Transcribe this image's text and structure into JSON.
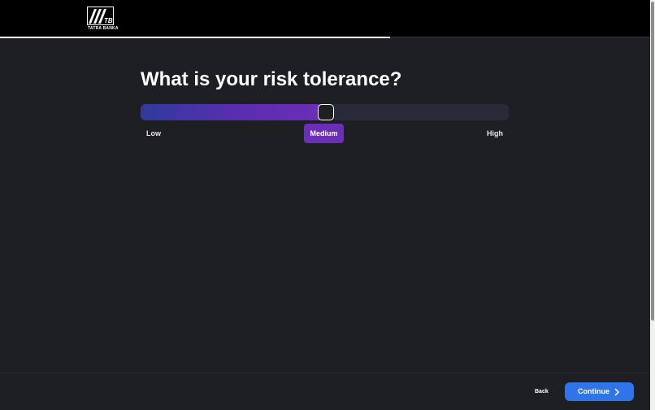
{
  "brand": {
    "logo_text": "TATRA BANKA",
    "logo_mark": "TB",
    "logo_icon": "tatra-banka-logo-icon"
  },
  "progress": {
    "fraction": 0.6
  },
  "question": {
    "title": "What is your risk tolerance?"
  },
  "risk_slider": {
    "options": [
      "Low",
      "Medium",
      "High"
    ],
    "selected": "Medium",
    "value_fraction": 0.5
  },
  "footer": {
    "back_label": "Back",
    "continue_label": "Continue",
    "continue_icon": "chevron-right-icon"
  },
  "colors": {
    "background": "#1e1f23",
    "header": "#000000",
    "accent_purple": "#6a2fb8",
    "accent_blue": "#2f74e8",
    "slider_start": "#2f3b9c",
    "track": "#272a38"
  }
}
